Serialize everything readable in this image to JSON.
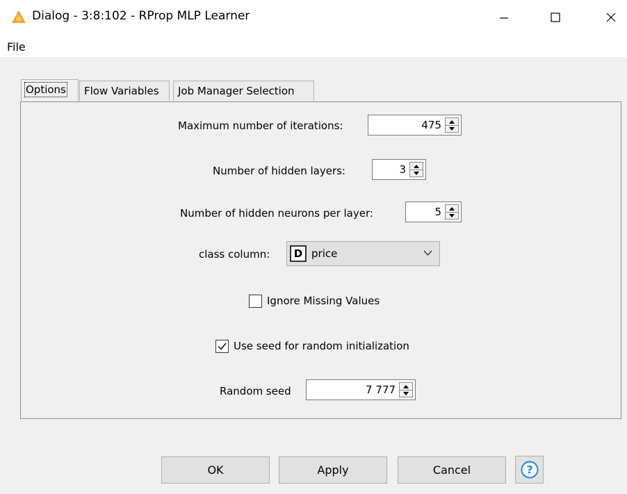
{
  "window": {
    "title": "Dialog - 3:8:102 - RProp MLP Learner"
  },
  "menu": {
    "file": "File"
  },
  "tabs": [
    {
      "label": "Options"
    },
    {
      "label": "Flow Variables"
    },
    {
      "label": "Job Manager Selection"
    }
  ],
  "options": {
    "max_iterations": {
      "label": "Maximum number of iterations:",
      "value": "475"
    },
    "hidden_layers": {
      "label": "Number of hidden layers:",
      "value": "3"
    },
    "hidden_neurons": {
      "label": "Number of hidden neurons per layer:",
      "value": "5"
    },
    "class_column": {
      "label": "class column:",
      "type_badge": "D",
      "value": "price"
    },
    "ignore_missing": {
      "label": "Ignore Missing Values",
      "checked": false
    },
    "use_seed": {
      "label": "Use seed for random initialization",
      "checked": true
    },
    "random_seed": {
      "label": "Random seed",
      "value": "7 777"
    }
  },
  "buttons": {
    "ok": "OK",
    "apply": "Apply",
    "cancel": "Cancel"
  },
  "colors": {
    "accent": "#f5a623",
    "help_blue": "#1e88e5"
  }
}
